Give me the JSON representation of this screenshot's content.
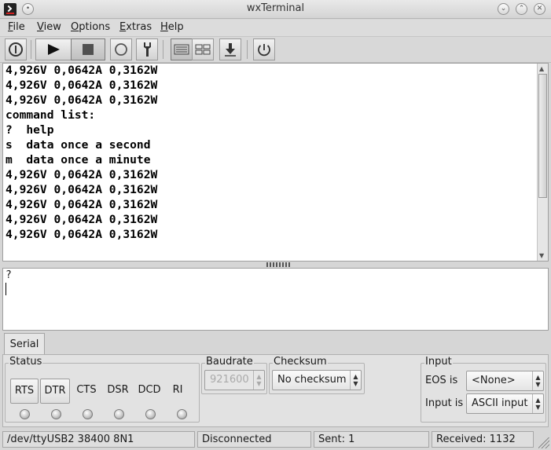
{
  "window": {
    "title": "wxTerminal"
  },
  "menu": {
    "items": [
      {
        "label": "File",
        "key": "F",
        "rest": "ile"
      },
      {
        "label": "View",
        "key": "V",
        "rest": "iew"
      },
      {
        "label": "Options",
        "key": "O",
        "rest": "ptions"
      },
      {
        "label": "Extras",
        "key": "E",
        "rest": "xtras"
      },
      {
        "label": "Help",
        "key": "H",
        "rest": "elp"
      }
    ]
  },
  "toolbar": {
    "icons": [
      "power-icon",
      "play-icon",
      "stop-icon",
      "circle-icon",
      "wrench-icon",
      "lines-view-icon",
      "grid-view-icon",
      "download-icon",
      "reset-icon"
    ]
  },
  "output": {
    "lines": [
      "4,926V 0,0642A 0,3162W",
      "4,926V 0,0642A 0,3162W",
      "4,926V 0,0642A 0,3162W",
      "command list:",
      "?  help",
      "s  data once a second",
      "m  data once a minute",
      "4,926V 0,0642A 0,3162W",
      "4,926V 0,0642A 0,3162W",
      "4,926V 0,0642A 0,3162W",
      "4,926V 0,0642A 0,3162W",
      "4,926V 0,0642A 0,3162W"
    ]
  },
  "input": {
    "value": "?"
  },
  "tabs": {
    "serial": "Serial"
  },
  "status_group": {
    "label": "Status",
    "signals": [
      "RTS",
      "DTR",
      "CTS",
      "DSR",
      "DCD",
      "RI"
    ]
  },
  "baudrate": {
    "label": "Baudrate",
    "value": "921600"
  },
  "checksum": {
    "label": "Checksum",
    "value": "No checksum"
  },
  "input_group": {
    "label": "Input",
    "eos_label": "EOS is",
    "eos_value": "<None>",
    "inputis_label": "Input is",
    "inputis_value": "ASCII input"
  },
  "statusbar": {
    "port": "/dev/ttyUSB2 38400 8N1",
    "connection": "Disconnected",
    "sent": "Sent: 1",
    "received": "Received: 1132"
  }
}
